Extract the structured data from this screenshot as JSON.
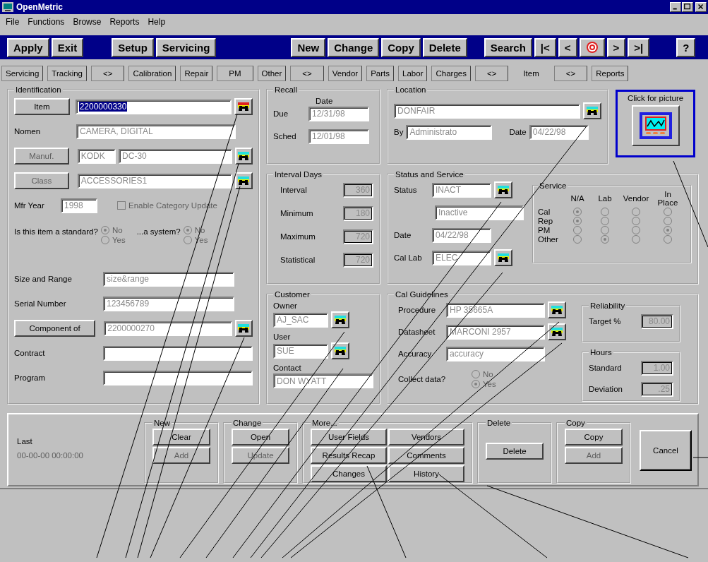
{
  "window": {
    "title": "OpenMetric"
  },
  "menu": [
    "File",
    "Functions",
    "Browse",
    "Reports",
    "Help"
  ],
  "toolbar": [
    [
      {
        "kind": "text",
        "label": "Apply"
      },
      {
        "kind": "text",
        "label": "Exit"
      }
    ],
    [
      {
        "kind": "text",
        "label": "Setup"
      },
      {
        "kind": "text",
        "label": "Servicing"
      }
    ],
    [
      {
        "kind": "text",
        "label": "New"
      },
      {
        "kind": "text",
        "label": "Change"
      },
      {
        "kind": "text",
        "label": "Copy"
      },
      {
        "kind": "text",
        "label": "Delete"
      }
    ],
    [
      {
        "kind": "text",
        "label": "Search"
      },
      {
        "kind": "text",
        "label": "|<"
      },
      {
        "kind": "text",
        "label": "<"
      },
      {
        "kind": "target"
      },
      {
        "kind": "text",
        "label": ">"
      },
      {
        "kind": "text",
        "label": ">|"
      }
    ],
    [
      {
        "kind": "text",
        "label": "?"
      }
    ]
  ],
  "tabs": [
    {
      "label": "Servicing",
      "selected": false
    },
    {
      "label": "Tracking",
      "selected": false
    },
    {
      "label": "<>",
      "selected": false
    },
    {
      "label": "Calibration",
      "selected": false
    },
    {
      "label": "Repair",
      "selected": false
    },
    {
      "label": "PM",
      "selected": false
    },
    {
      "label": "Other",
      "selected": false
    },
    {
      "label": "<>",
      "selected": false
    },
    {
      "label": "Vendor",
      "selected": false
    },
    {
      "label": "Parts",
      "selected": false
    },
    {
      "label": "Labor",
      "selected": false
    },
    {
      "label": "Charges",
      "selected": false
    },
    {
      "label": "<>",
      "selected": false
    },
    {
      "label": "Item",
      "selected": true
    },
    {
      "label": "<>",
      "selected": false
    },
    {
      "label": "Reports",
      "selected": false
    }
  ],
  "identification": {
    "title": "Identification",
    "item": {
      "button": "Item",
      "value": "2200000330",
      "selected": true
    },
    "nomen": {
      "label": "Nomen",
      "value": "CAMERA, DIGITAL"
    },
    "manufacturer": {
      "button": "Manuf.",
      "disabled": true,
      "code": "KODK",
      "model": "DC-30"
    },
    "class": {
      "button": "Class",
      "disabled": true,
      "value": "ACCESSORIES1"
    },
    "mfr_year": {
      "label": "Mfr Year",
      "value": "1998"
    },
    "enable_category_update": {
      "label": "Enable Category Update",
      "checked": false,
      "disabled": true
    },
    "standard": {
      "label": "Is this item a standard?",
      "options": [
        {
          "label": "No",
          "selected": true
        },
        {
          "label": "Yes",
          "selected": false
        }
      ]
    },
    "system": {
      "label": "...a system?",
      "options": [
        {
          "label": "No",
          "selected": true
        },
        {
          "label": "Yes",
          "selected": false
        }
      ]
    },
    "size_range": {
      "label": "Size and Range",
      "value": "size&range"
    },
    "serial": {
      "label": "Serial Number",
      "value": "123456789"
    },
    "component_of": {
      "button": "Component of",
      "value": "2200000270"
    },
    "contract": {
      "label": "Contract"
    },
    "program": {
      "label": "Program"
    }
  },
  "recall": {
    "title": "Recall",
    "date_header": "Date",
    "due": {
      "label": "Due",
      "value": "12/31/98"
    },
    "sched": {
      "label": "Sched",
      "value": "12/01/98"
    }
  },
  "location": {
    "title": "Location",
    "value": "DONFAIR",
    "by": {
      "label": "By",
      "value": "Administrato"
    },
    "date": {
      "label": "Date",
      "value": "04/22/98"
    }
  },
  "picture": {
    "caption": "Click for picture"
  },
  "interval_days": {
    "title": "Interval Days",
    "rows": [
      {
        "label": "Interval",
        "value": "360"
      },
      {
        "label": "Minimum",
        "value": "180"
      },
      {
        "label": "Maximum",
        "value": "720"
      },
      {
        "label": "Statistical",
        "value": "720"
      }
    ]
  },
  "status_service": {
    "title": "Status and Service",
    "status": {
      "label": "Status",
      "value": "INACT"
    },
    "description": "Inactive",
    "date": {
      "label": "Date",
      "value": "04/22/98"
    },
    "cal_lab": {
      "label": "Cal Lab",
      "value": "ELEC"
    }
  },
  "service": {
    "title": "Service",
    "columns": [
      "N/A",
      "Lab",
      "Vendor",
      "In Place"
    ],
    "rows": [
      {
        "label": "Cal",
        "cells": [
          {
            "selected": true
          },
          {
            "selected": false
          },
          {
            "selected": false
          },
          {
            "selected": false
          }
        ]
      },
      {
        "label": "Rep",
        "cells": [
          {
            "selected": true
          },
          {
            "selected": false
          },
          {
            "selected": false
          },
          {
            "selected": false
          }
        ]
      },
      {
        "label": "PM",
        "cells": [
          {
            "selected": false
          },
          {
            "selected": false
          },
          {
            "selected": false
          },
          {
            "selected": true
          }
        ]
      },
      {
        "label": "Other",
        "cells": [
          {
            "selected": false
          },
          {
            "selected": true
          },
          {
            "selected": false
          },
          {
            "selected": false
          }
        ]
      }
    ]
  },
  "customer": {
    "title": "Customer",
    "owner": {
      "label": "Owner",
      "value": "AJ_SAC"
    },
    "user": {
      "label": "User",
      "value": "SUE"
    },
    "contact": {
      "label": "Contact",
      "value": "DON WYATT"
    }
  },
  "cal_guidelines": {
    "title": "Cal Guidelines",
    "procedure": {
      "label": "Procedure",
      "value": "HP 35665A"
    },
    "datasheet": {
      "label": "Datasheet",
      "value": "MARCONI 2957"
    },
    "accuracy": {
      "label": "Accuracy",
      "value": "accuracy"
    },
    "collect": {
      "label": "Collect data?",
      "options": [
        {
          "label": "No",
          "selected": false
        },
        {
          "label": "Yes",
          "selected": true
        }
      ]
    }
  },
  "reliability": {
    "title": "Reliability",
    "target": {
      "label": "Target %",
      "value": "80.00"
    }
  },
  "hours": {
    "title": "Hours",
    "rows": [
      {
        "label": "Standard",
        "value": "1.00"
      },
      {
        "label": "Deviation",
        "value": ".25"
      }
    ]
  },
  "bottom": {
    "last": {
      "label": "Last",
      "value": "00-00-00 00:00:00"
    },
    "groups": [
      {
        "title": "New",
        "buttons": [
          {
            "label": "Clear",
            "disabled": false
          },
          {
            "label": "Add",
            "disabled": true
          }
        ]
      },
      {
        "title": "Change",
        "buttons": [
          {
            "label": "Open",
            "disabled": false
          },
          {
            "label": "Update",
            "disabled": true
          }
        ]
      },
      {
        "title": "More...",
        "buttons": [
          {
            "label": "User Fields",
            "disabled": false
          },
          {
            "label": "Vendors",
            "disabled": false
          },
          {
            "label": "Results Recap",
            "disabled": false
          },
          {
            "label": "Comments",
            "disabled": false
          },
          {
            "label": "Changes",
            "disabled": false
          },
          {
            "label": "History",
            "disabled": false
          }
        ]
      },
      {
        "title": "Delete",
        "buttons": [
          {
            "label": "Delete",
            "disabled": false
          }
        ]
      },
      {
        "title": "Copy",
        "buttons": [
          {
            "label": "Copy",
            "disabled": false
          },
          {
            "label": "Add",
            "disabled": true
          }
        ]
      }
    ],
    "cancel": "Cancel"
  }
}
